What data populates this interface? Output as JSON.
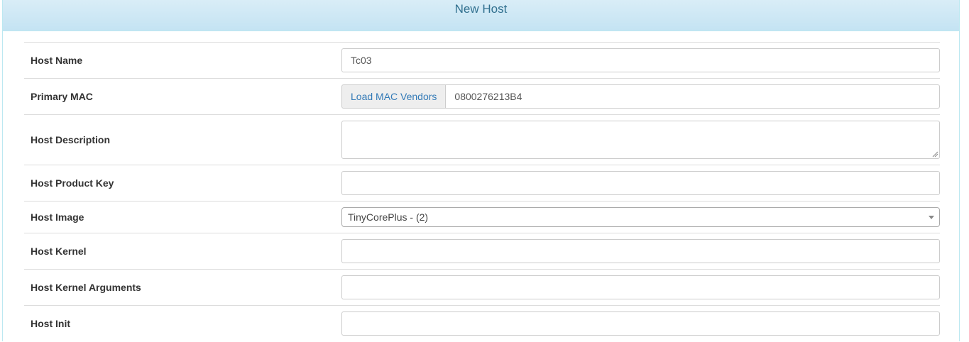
{
  "panel": {
    "title": "New Host"
  },
  "form": {
    "host_name": {
      "label": "Host Name",
      "value": "Tc03"
    },
    "primary_mac": {
      "label": "Primary MAC",
      "button": "Load MAC Vendors",
      "value": "0800276213B4"
    },
    "host_description": {
      "label": "Host Description",
      "value": ""
    },
    "host_product_key": {
      "label": "Host Product Key",
      "value": ""
    },
    "host_image": {
      "label": "Host Image",
      "selected": "TinyCorePlus - (2)"
    },
    "host_kernel": {
      "label": "Host Kernel",
      "value": ""
    },
    "host_kernel_arguments": {
      "label": "Host Kernel Arguments",
      "value": ""
    },
    "host_init": {
      "label": "Host Init",
      "value": ""
    }
  },
  "icons": {
    "select_caret": "chevron-down-icon",
    "textarea_grip": "resize-grip-icon"
  },
  "colors": {
    "heading_bg": "#d9edf7",
    "heading_text": "#31708f",
    "link": "#337ab7"
  }
}
